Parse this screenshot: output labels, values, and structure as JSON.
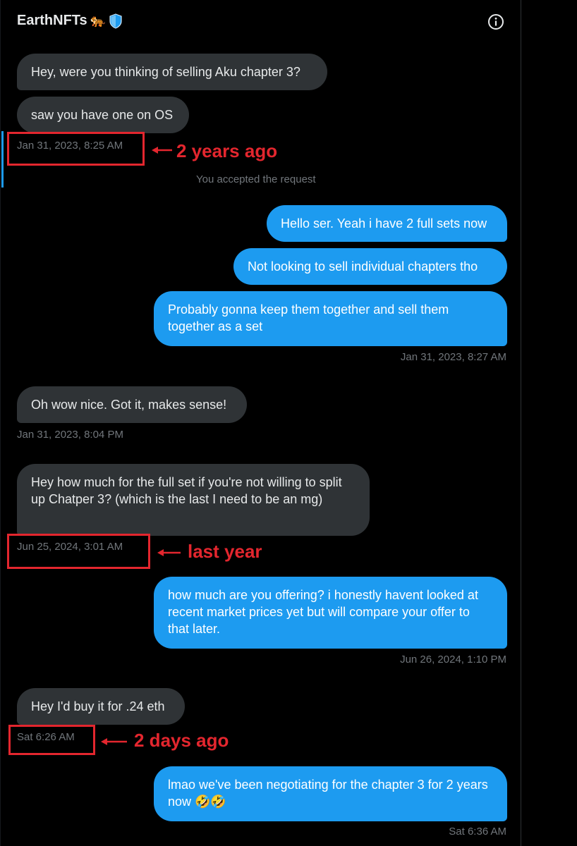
{
  "header": {
    "title": "EarthNFTs",
    "title_emoji": "🐅",
    "icons": [
      "tiger-emoji-icon",
      "verified-shield-icon",
      "info-icon"
    ]
  },
  "messages": [
    {
      "from": "them",
      "text": "Hey, were you thinking of selling Aku chapter 3?"
    },
    {
      "from": "them",
      "text": "saw you have one on OS"
    },
    {
      "from": "them",
      "timestamp": "Jan 31, 2023, 8:25 AM"
    },
    {
      "system": "You accepted the request"
    },
    {
      "from": "me",
      "text": "Hello ser. Yeah i have 2 full sets now"
    },
    {
      "from": "me",
      "text": "Not looking to sell individual chapters tho"
    },
    {
      "from": "me",
      "text": "Probably gonna keep them together and sell them together as a set"
    },
    {
      "from": "me",
      "timestamp": "Jan 31, 2023, 8:27 AM"
    },
    {
      "from": "them",
      "text": "Oh wow nice. Got it, makes sense!"
    },
    {
      "from": "them",
      "timestamp": "Jan 31, 2023, 8:04 PM"
    },
    {
      "from": "them",
      "text": "Hey how much for the full set if you're not willing to split up Chatper 3? (which is the last I need to be an mg)"
    },
    {
      "from": "them",
      "timestamp": "Jun 25, 2024, 3:01 AM"
    },
    {
      "from": "me",
      "text": "how much are you offering? i honestly havent looked at recent market prices yet but will compare your offer to that later."
    },
    {
      "from": "me",
      "timestamp": "Jun 26, 2024, 1:10 PM"
    },
    {
      "from": "them",
      "text": "Hey I'd buy it for .24 eth"
    },
    {
      "from": "them",
      "timestamp": "Sat 6:26 AM"
    },
    {
      "from": "me",
      "text": "lmao we've been negotiating for the chapter 3 for 2 years now 🤣🤣"
    },
    {
      "from": "me",
      "timestamp": "Sat 6:36 AM"
    }
  ],
  "annotations": [
    {
      "label": "2 years ago",
      "color": "#e3262e"
    },
    {
      "label": "last year",
      "color": "#e3262e"
    },
    {
      "label": "2 days ago",
      "color": "#e3262e"
    }
  ],
  "colors": {
    "background": "#000000",
    "incoming_bubble": "#2f3336",
    "outgoing_bubble": "#1d9bf0",
    "timestamp": "#71767b",
    "annotation": "#e3262e"
  }
}
